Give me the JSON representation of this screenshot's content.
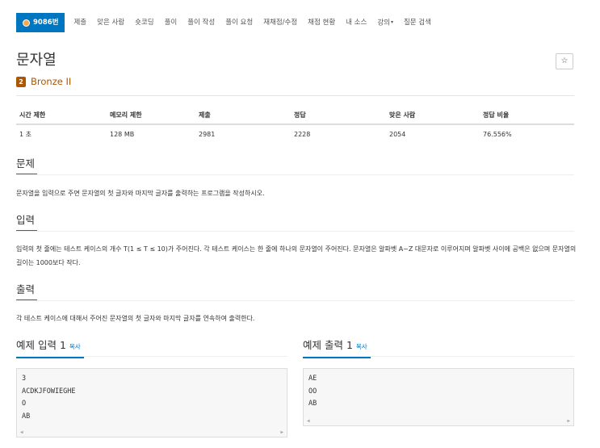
{
  "nav": {
    "tabs": [
      {
        "label": "9086번",
        "active": true
      },
      {
        "label": "제출"
      },
      {
        "label": "맞은 사람"
      },
      {
        "label": "숏코딩"
      },
      {
        "label": "풀이"
      },
      {
        "label": "풀이 작성"
      },
      {
        "label": "풀이 요청"
      },
      {
        "label": "재채점/수정"
      },
      {
        "label": "채점 현황"
      },
      {
        "label": "내 소스"
      },
      {
        "label": "강의",
        "dropdown": true
      },
      {
        "label": "질문 검색"
      }
    ]
  },
  "problem": {
    "title": "문자열",
    "star_icon": "☆",
    "tier": {
      "badge": "2",
      "label": "Bronze II",
      "color": "#ad5600"
    }
  },
  "info_table": {
    "headers": [
      "시간 제한",
      "메모리 제한",
      "제출",
      "정답",
      "맞은 사람",
      "정답 비율"
    ],
    "values": [
      "1 초",
      "128 MB",
      "2981",
      "2228",
      "2054",
      "76.556%"
    ]
  },
  "sections": {
    "problem": {
      "heading": "문제",
      "text": "문자열을 입력으로 주면 문자열의 첫 글자와 마지막 글자를 출력하는 프로그램을 작성하시오."
    },
    "input": {
      "heading": "입력",
      "text": "입력의 첫 줄에는 테스트 케이스의 개수 T(1 ≤ T ≤ 10)가 주어진다. 각 테스트 케이스는 한 줄에 하나의 문자열이 주어진다. 문자열은 알파벳 A~Z 대문자로 이루어지며 알파벳 사이에 공백은 없으며 문자열의 길이는 1000보다 작다."
    },
    "output": {
      "heading": "출력",
      "text": "각 테스트 케이스에 대해서 주어진 문자열의 첫 글자와 마지막 글자를 연속하여 출력한다."
    }
  },
  "samples": {
    "input": {
      "heading": "예제 입력 1",
      "copy_label": "복사",
      "lines": [
        "3",
        "ACDKJFOWIEGHE",
        "O",
        "AB"
      ]
    },
    "output": {
      "heading": "예제 출력 1",
      "copy_label": "복사",
      "lines": [
        "AE",
        "OO",
        "AB"
      ]
    }
  },
  "colors": {
    "accent": "#0076c0",
    "bronze": "#ad5600"
  }
}
